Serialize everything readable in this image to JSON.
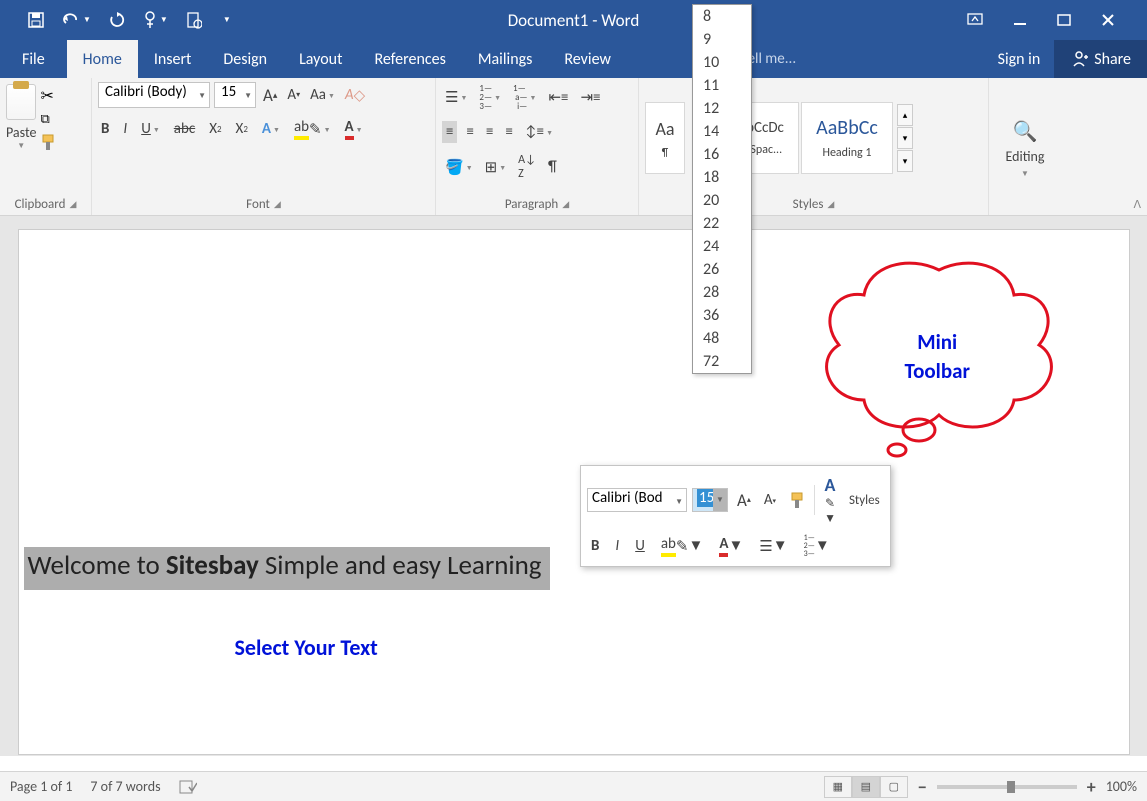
{
  "title": "Document1 - Word",
  "qat": {
    "save": "💾",
    "undo": "↶",
    "redo": "↻"
  },
  "menus": [
    "File",
    "Home",
    "Insert",
    "Design",
    "Layout",
    "References",
    "Mailings",
    "Review"
  ],
  "tell_me": "Tell me...",
  "signin": "Sign in",
  "share": "Share",
  "ribbon": {
    "clipboard": {
      "label": "Clipboard",
      "paste": "Paste"
    },
    "font": {
      "label": "Font",
      "name": "Calibri (Body)",
      "size": "15"
    },
    "paragraph": {
      "label": "Paragraph"
    },
    "styles": {
      "label": "Styles",
      "s1_prev": "Aa",
      "s2_prev": "AaBbCcDc",
      "s2_lbl": "¶ No Spac...",
      "s3_prev": "AaBbCc",
      "s3_lbl": "Heading 1"
    },
    "editing": {
      "label": "Editing"
    }
  },
  "size_options": [
    "8",
    "9",
    "10",
    "11",
    "12",
    "14",
    "16",
    "18",
    "20",
    "22",
    "24",
    "26",
    "28",
    "36",
    "48",
    "72"
  ],
  "doc": {
    "selected_pre": "Welcome to ",
    "selected_bold": "Sitesbay",
    "selected_post": " Simple and easy Learning",
    "blue": "Select Your Text",
    "cloud1": "Mini",
    "cloud2": "Toolbar"
  },
  "mini": {
    "font": "Calibri (Bod",
    "size": "15",
    "styles": "Styles"
  },
  "status": {
    "page": "Page 1 of 1",
    "words": "7 of 7 words",
    "zoom": "100%"
  }
}
